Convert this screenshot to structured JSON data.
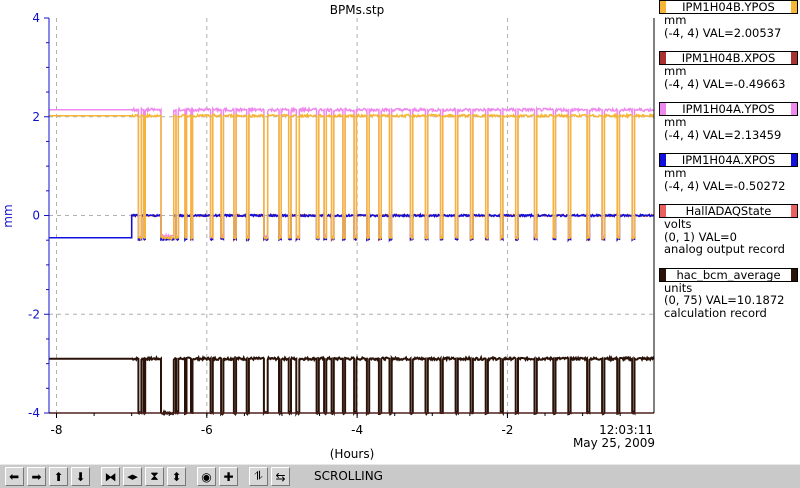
{
  "chart_data": {
    "type": "line",
    "title": "BPMs.stp",
    "ylabel": "mm",
    "xlabel": "(Hours)",
    "xlim": [
      -8.1,
      -0.05
    ],
    "ylim": [
      -4,
      4
    ],
    "x_ticks": [
      -8,
      -6,
      -4,
      -2
    ],
    "y_ticks": [
      -4,
      -2,
      0,
      2,
      4
    ],
    "grid": true,
    "end_time": "12:03:11",
    "end_date": "May 25, 2009",
    "series": [
      {
        "name": "IPM1H04B.YPOS",
        "color": "#f5b535",
        "unit": "mm",
        "range": "(-4, 4)",
        "value_text": "VAL=2.00537",
        "high": 2.02,
        "low": -0.45
      },
      {
        "name": "IPM1H04B.XPOS",
        "color": "#a83232",
        "unit": "mm",
        "range": "(-4, 4)",
        "value_text": "VAL=-0.49663",
        "high": 0.0,
        "low": -0.48
      },
      {
        "name": "IPM1H04A.YPOS",
        "color": "#ee88ee",
        "unit": "mm",
        "range": "(-4, 4)",
        "value_text": "VAL=2.13459",
        "high": 2.14,
        "low": -0.42
      },
      {
        "name": "IPM1H04A.XPOS",
        "color": "#1010dd",
        "unit": "mm",
        "range": "(-4, 4)",
        "value_text": "VAL=-0.50272",
        "high": 0.0,
        "low": -0.48
      },
      {
        "name": "HallADAQState",
        "color": "#e86060",
        "unit": "volts",
        "range": "(0, 1)",
        "value_text": "VAL=0",
        "record": "analog output record",
        "value": -4.0
      },
      {
        "name": "hac_bcm_average",
        "color": "#2a1208",
        "unit": "units",
        "range": "(0, 75)",
        "value_text": "VAL=10.1872",
        "record": "calculation record",
        "high": -2.9,
        "low": -4.0
      }
    ],
    "beam_off_intervals": [
      [
        -7.05,
        -7.02
      ],
      [
        -6.92,
        -6.88
      ],
      [
        -6.85,
        -6.83
      ],
      [
        -6.62,
        -6.45
      ],
      [
        -6.42,
        -6.39
      ],
      [
        -6.3,
        -6.28
      ],
      [
        -6.22,
        -6.2
      ],
      [
        -5.96,
        -5.93
      ],
      [
        -5.82,
        -5.79
      ],
      [
        -5.65,
        -5.62
      ],
      [
        -5.48,
        -5.45
      ],
      [
        -5.25,
        -5.2
      ],
      [
        -5.05,
        -5.02
      ],
      [
        -4.92,
        -4.89
      ],
      [
        -4.82,
        -4.78
      ],
      [
        -4.55,
        -4.52
      ],
      [
        -4.45,
        -4.42
      ],
      [
        -4.35,
        -4.32
      ],
      [
        -4.2,
        -4.17
      ],
      [
        -4.05,
        -4.02
      ],
      [
        -3.88,
        -3.85
      ],
      [
        -3.72,
        -3.69
      ],
      [
        -3.58,
        -3.55
      ],
      [
        -3.3,
        -3.27
      ],
      [
        -3.1,
        -3.07
      ],
      [
        -2.9,
        -2.87
      ],
      [
        -2.7,
        -2.67
      ],
      [
        -2.5,
        -2.47
      ],
      [
        -2.3,
        -2.27
      ],
      [
        -2.1,
        -2.07
      ],
      [
        -1.9,
        -1.87
      ],
      [
        -1.65,
        -1.62
      ],
      [
        -1.4,
        -1.37
      ],
      [
        -1.2,
        -1.17
      ],
      [
        -0.95,
        -0.92
      ],
      [
        -0.75,
        -0.72
      ],
      [
        -0.55,
        -0.52
      ],
      [
        -0.35,
        -0.32
      ]
    ]
  },
  "toolbar": {
    "buttons": [
      {
        "name": "scroll-left-icon",
        "glyph": "➡",
        "rot": 180
      },
      {
        "name": "scroll-right-icon",
        "glyph": "➡",
        "rot": 0
      },
      {
        "name": "scroll-up-icon",
        "glyph": "⬆",
        "rot": 0
      },
      {
        "name": "scroll-down-icon",
        "glyph": "⬇",
        "rot": 0
      },
      {
        "name": "zoom-in-x-icon",
        "glyph": "⧓",
        "rot": 0
      },
      {
        "name": "zoom-out-x-icon",
        "glyph": "◀▶",
        "rot": 0
      },
      {
        "name": "zoom-in-y-icon",
        "glyph": "⧗",
        "rot": 0
      },
      {
        "name": "zoom-out-y-icon",
        "glyph": "⬍",
        "rot": 0
      },
      {
        "name": "zoom-center-icon",
        "glyph": "◉",
        "rot": 0
      },
      {
        "name": "zoom-full-icon",
        "glyph": "✚",
        "rot": 0
      },
      {
        "name": "reset-icon",
        "glyph": "⥮",
        "rot": 0
      },
      {
        "name": "scroll-toggle-icon",
        "glyph": "⇆",
        "rot": 0
      }
    ],
    "status": "SCROLLING"
  }
}
